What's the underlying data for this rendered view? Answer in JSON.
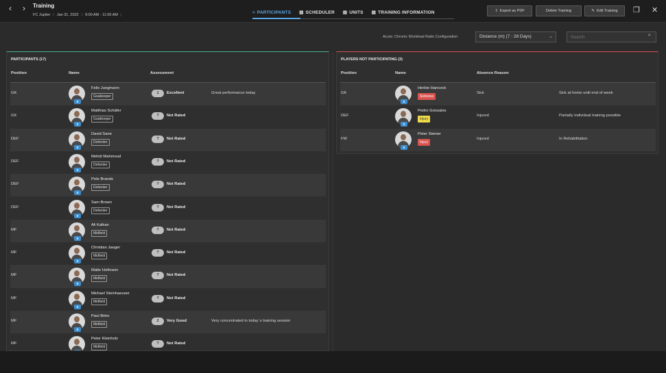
{
  "header": {
    "back_icon": "chevron-left-icon",
    "forward_icon": "chevron-right-icon",
    "title": "Training",
    "team": "FC Jupiter",
    "date": "Jan 31, 2022",
    "time": "9:00 AM - 11:00 AM",
    "sep": "|",
    "tabs": [
      {
        "label": "PARTICIPANTS",
        "icon": "participants-icon",
        "active": true
      },
      {
        "label": "SCHEDULER",
        "icon": "document-icon",
        "active": false
      },
      {
        "label": "UNITS",
        "icon": "document-icon",
        "active": false
      },
      {
        "label": "TRAINING INFORMATION",
        "icon": "document-icon",
        "active": false
      }
    ],
    "export_label": "Export as PDF",
    "delete_label": "Delete Training",
    "edit_label": "Edit Training"
  },
  "filters": {
    "acwr_label": "Acute: Chronic Workload Ratio Configuration",
    "acwr_value": "Distance (m) (7 : 28 Days)",
    "search_placeholder": "Search"
  },
  "participants": {
    "title": "PARTICIPANTS (17)",
    "columns": {
      "position": "Position",
      "name": "Name",
      "assessment": "Assessment"
    },
    "rows": [
      {
        "position": "GK",
        "name": "Felix Jungmann",
        "role": "Goalkeeper",
        "badge": "0",
        "rating": "1",
        "rating_label": "Excellent",
        "comment": "Great performance today"
      },
      {
        "position": "GK",
        "name": "Matthias Schäfer",
        "role": "Goalkeeper",
        "badge": "0",
        "rating": "?",
        "rating_label": "Not Rated",
        "comment": ""
      },
      {
        "position": "DEF",
        "name": "David Sane",
        "role": "Defender",
        "badge": "0",
        "rating": "?",
        "rating_label": "Not Rated",
        "comment": ""
      },
      {
        "position": "DEF",
        "name": "Mehdi Mahmoud",
        "role": "Defender",
        "badge": "0",
        "rating": "?",
        "rating_label": "Not Rated",
        "comment": ""
      },
      {
        "position": "DEF",
        "name": "Pete Brando",
        "role": "Defender",
        "badge": "0",
        "rating": "?",
        "rating_label": "Not Rated",
        "comment": ""
      },
      {
        "position": "DEF",
        "name": "Sam Brown",
        "role": "Defender",
        "badge": "0",
        "rating": "?",
        "rating_label": "Not Rated",
        "comment": ""
      },
      {
        "position": "MF",
        "name": "Ali Kalkan",
        "role": "Midfield",
        "badge": "0",
        "rating": "?",
        "rating_label": "Not Rated",
        "comment": ""
      },
      {
        "position": "MF",
        "name": "Christian Jaeger",
        "role": "Midfield",
        "badge": "0",
        "rating": "?",
        "rating_label": "Not Rated",
        "comment": ""
      },
      {
        "position": "MF",
        "name": "Malte Hofmann",
        "role": "Midfield",
        "badge": "0",
        "rating": "?",
        "rating_label": "Not Rated",
        "comment": ""
      },
      {
        "position": "MF",
        "name": "Michael Steinhaeuser",
        "role": "Midfield",
        "badge": "0",
        "rating": "?",
        "rating_label": "Not Rated",
        "comment": ""
      },
      {
        "position": "MF",
        "name": "Paul Birke",
        "role": "Midfield",
        "badge": "0",
        "rating": "2",
        "rating_label": "Very Good",
        "comment": "Very concentrated in today´s training session"
      },
      {
        "position": "MF",
        "name": "Peter Kleinholz",
        "role": "Midfield",
        "badge": "0",
        "rating": "?",
        "rating_label": "Not Rated",
        "comment": ""
      }
    ]
  },
  "not_participating": {
    "title": "PLAYERS NOT PARTICIPATING (3)",
    "columns": {
      "position": "Position",
      "name": "Name",
      "reason": "Absence Reason"
    },
    "rows": [
      {
        "position": "GK",
        "name": "Herbie Hancock",
        "tag": "Sickness",
        "tag_color": "#d9534f",
        "badge": "0",
        "reason": "Sick",
        "note": "Sick at home until end of week"
      },
      {
        "position": "DEF",
        "name": "Pedro Gonzales",
        "tag": "Injury",
        "tag_color": "#f0d94a",
        "badge": "0",
        "reason": "Injured",
        "note": "Partially individual training possible"
      },
      {
        "position": "FW",
        "name": "Peter Steiner",
        "tag": "Injury",
        "tag_color": "#d9534f",
        "badge": "0",
        "reason": "Injured",
        "note": "In Rehabilitation"
      }
    ]
  }
}
